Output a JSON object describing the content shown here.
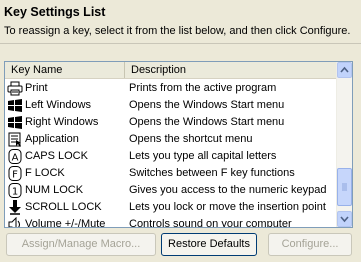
{
  "header": {
    "title": "Key Settings List",
    "instruction": "To reassign a key, select it from the list below, and then click Configure."
  },
  "list": {
    "columns": {
      "key_name": "Key Name",
      "description": "Description"
    },
    "rows": [
      {
        "key": "Print",
        "description": "Prints from the active program",
        "icon": "printer-icon"
      },
      {
        "key": "Left Windows",
        "description": "Opens the Windows Start menu",
        "icon": "windows-logo-icon"
      },
      {
        "key": "Right Windows",
        "description": "Opens the Windows Start menu",
        "icon": "windows-logo-icon"
      },
      {
        "key": "Application",
        "description": "Opens the shortcut menu",
        "icon": "application-menu-icon"
      },
      {
        "key": "CAPS LOCK",
        "description": "Lets you type all capital letters",
        "icon": "caps-lock-icon"
      },
      {
        "key": "F LOCK",
        "description": "Switches between F key functions",
        "icon": "f-lock-icon"
      },
      {
        "key": "NUM LOCK",
        "description": "Gives you access to the numeric keypad",
        "icon": "num-lock-icon"
      },
      {
        "key": "SCROLL LOCK",
        "description": "Lets you lock or move the insertion point",
        "icon": "scroll-lock-icon"
      },
      {
        "key": "Volume +/-/Mute",
        "description": "Controls sound on your computer",
        "icon": "volume-icon"
      }
    ]
  },
  "buttons": {
    "assign": "Assign/Manage Macro...",
    "restore": "Restore Defaults",
    "configure": "Configure..."
  }
}
